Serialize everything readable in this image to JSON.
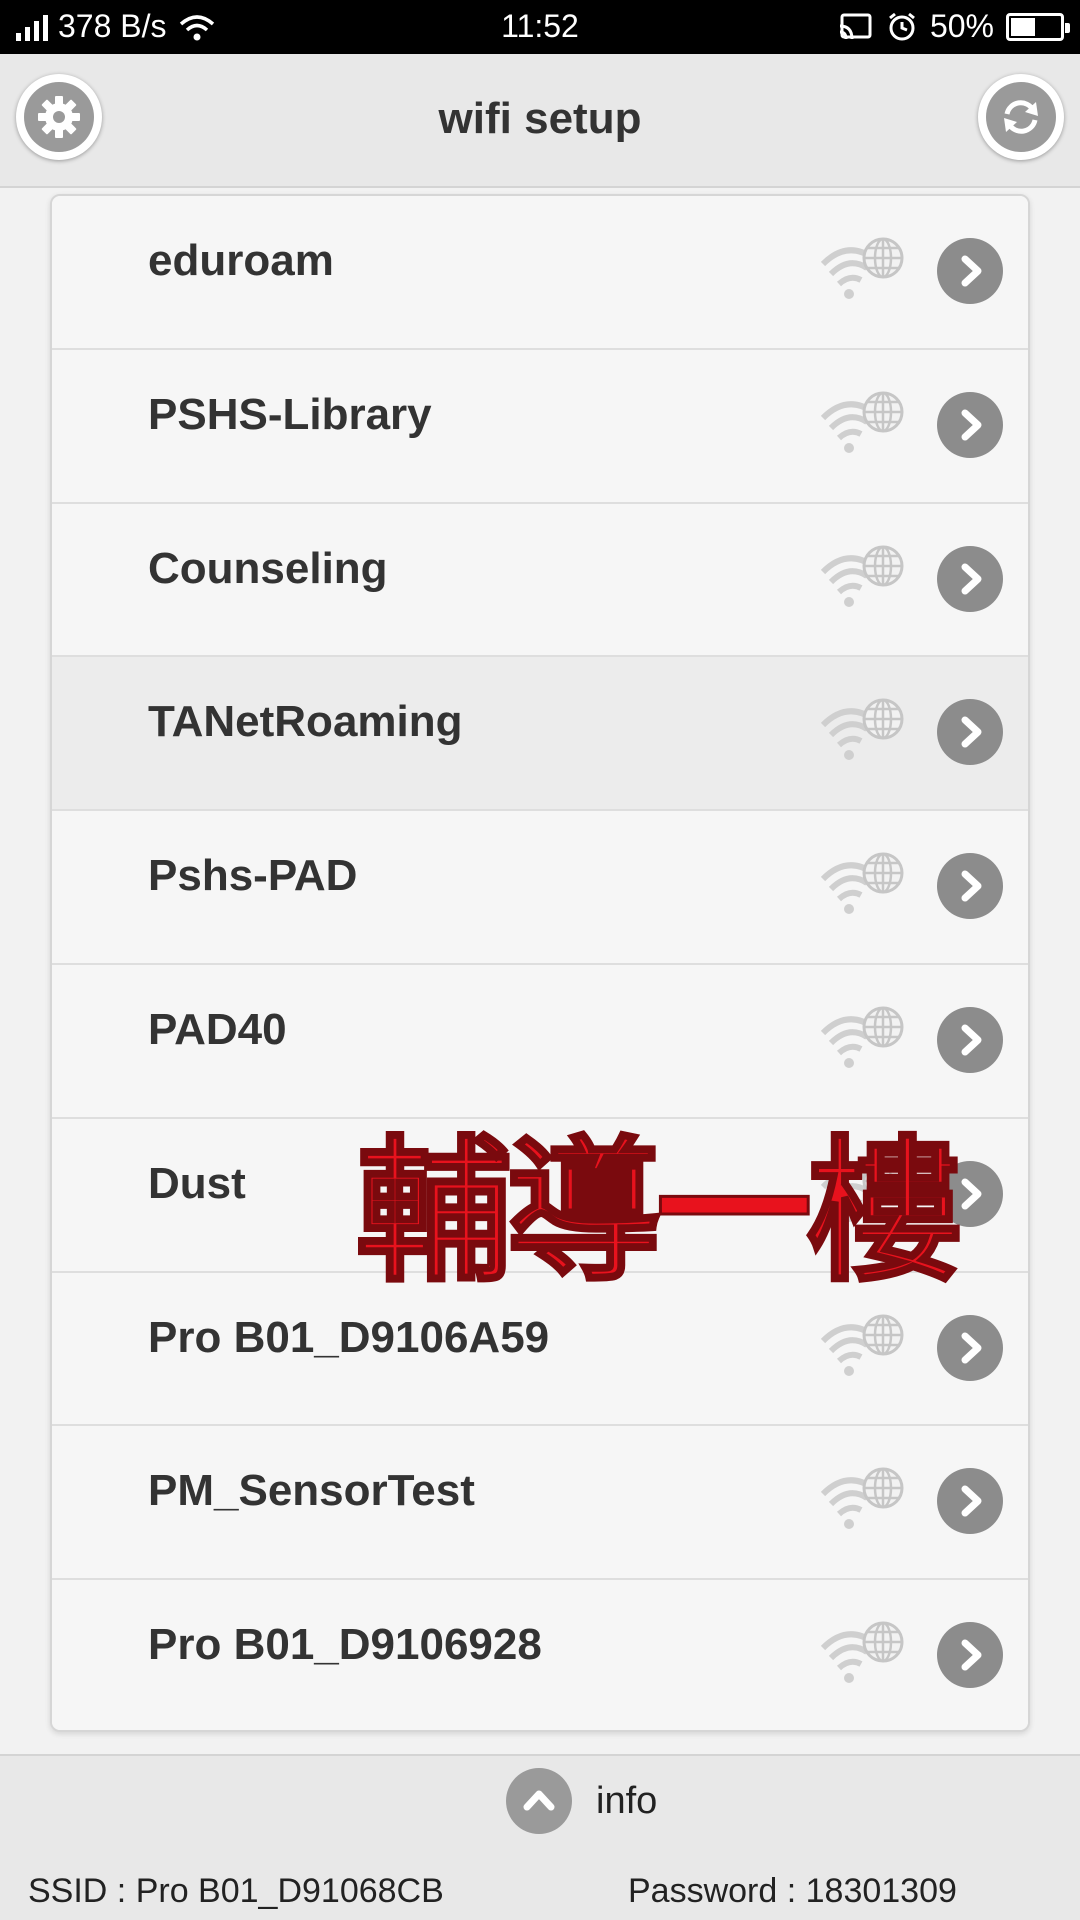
{
  "status_bar": {
    "net_speed": "378 B/s",
    "time": "11:52",
    "battery": "50%",
    "battery_level": 0.5
  },
  "header": {
    "title": "wifi setup",
    "left_icon": "gear-icon",
    "right_icon": "refresh-icon"
  },
  "networks": [
    {
      "ssid": "eduroam"
    },
    {
      "ssid": "PSHS-Library"
    },
    {
      "ssid": "Counseling"
    },
    {
      "ssid": "TANetRoaming"
    },
    {
      "ssid": "Pshs-PAD"
    },
    {
      "ssid": "PAD40"
    },
    {
      "ssid": "Dust"
    },
    {
      "ssid": "Pro B01_D9106A59"
    },
    {
      "ssid": "PM_SensorTest"
    },
    {
      "ssid": "Pro B01_D9106928"
    }
  ],
  "overlay": {
    "text": "輔導一樓",
    "color": "#e8121d"
  },
  "footer": {
    "info_label": "info",
    "ssid_line": "SSID : Pro B01_D91068CB",
    "password_line": "Password : 18301309"
  }
}
